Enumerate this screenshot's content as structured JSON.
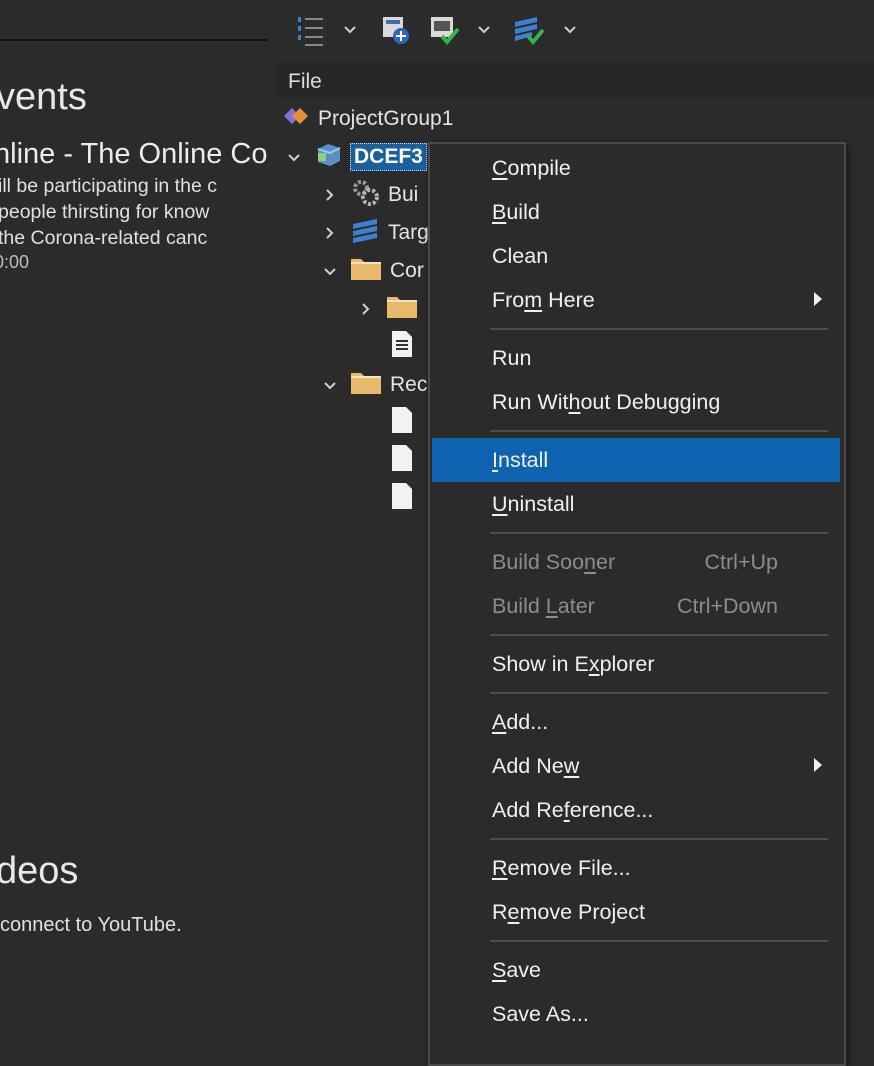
{
  "welcome": {
    "events_heading": "vents",
    "event_title": "nline - The Online Co",
    "event_lines": [
      "ill be participating in the c",
      " people thirsting for know",
      " the Corona-related canc"
    ],
    "event_date": "0:00",
    "videos_heading": "deos",
    "youtube_message": "connect to YouTube."
  },
  "project_manager": {
    "file_header": "File",
    "tree": {
      "group": "ProjectGroup1",
      "project": "DCEF3",
      "children": [
        "Bui",
        "Targ",
        "Cor",
        "",
        "",
        "Rec",
        "",
        "",
        ""
      ]
    }
  },
  "context_menu": {
    "items": [
      {
        "pre": "",
        "u": "C",
        "post": "ompile"
      },
      {
        "pre": "",
        "u": "B",
        "post": "uild"
      },
      {
        "pre": "Clean",
        "u": "",
        "post": ""
      },
      {
        "pre": "Fro",
        "u": "m",
        "post": " Here",
        "submenu": true
      },
      {
        "pre": "Run",
        "u": "",
        "post": ""
      },
      {
        "pre": "Run Wit",
        "u": "h",
        "post": "out Debugging"
      },
      {
        "pre": "",
        "u": "I",
        "post": "nstall",
        "highlighted": true
      },
      {
        "pre": "",
        "u": "U",
        "post": "ninstall"
      },
      {
        "pre": "Build Soo",
        "u": "n",
        "post": "er",
        "shortcut": "Ctrl+Up",
        "disabled": true
      },
      {
        "pre": "Build ",
        "u": "L",
        "post": "ater",
        "shortcut": "Ctrl+Down",
        "disabled": true
      },
      {
        "pre": "Show in E",
        "u": "x",
        "post": "plorer"
      },
      {
        "pre": "",
        "u": "A",
        "post": "dd..."
      },
      {
        "pre": "Add Ne",
        "u": "w",
        "post": "",
        "submenu": true
      },
      {
        "pre": "Add Re",
        "u": "f",
        "post": "erence..."
      },
      {
        "pre": "",
        "u": "R",
        "post": "emove File..."
      },
      {
        "pre": "R",
        "u": "e",
        "post": "move Project"
      },
      {
        "pre": "",
        "u": "S",
        "post": "ave"
      },
      {
        "pre": "Save As...",
        "u": "",
        "post": ""
      }
    ]
  },
  "colors": {
    "highlight": "#0e63b1",
    "selection": "#1a5f9e",
    "background": "#2b2b2b",
    "folder": "#e8b96a"
  }
}
